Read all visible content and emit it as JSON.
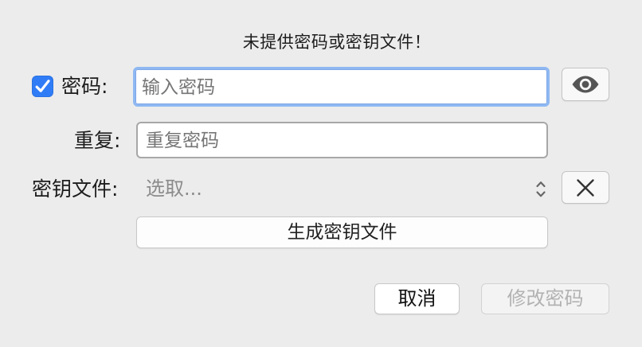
{
  "dialog": {
    "message": "未提供密码或密钥文件！"
  },
  "password": {
    "checkbox_checked": true,
    "label": "密码:",
    "placeholder": "输入密码",
    "value": ""
  },
  "repeat": {
    "label": "重复:",
    "placeholder": "重复密码",
    "value": ""
  },
  "key_file": {
    "label": "密钥文件:",
    "selected": "选取..."
  },
  "buttons": {
    "generate_key_file": "生成密钥文件",
    "cancel": "取消",
    "change_password": "修改密码",
    "change_password_enabled": false
  },
  "icons": {
    "password_visibility": "eye-icon",
    "clear_key_file": "close-icon",
    "select_chevrons": "chevron-up-down-icon",
    "checkbox": "checkmark-icon"
  },
  "colors": {
    "accent": "#2f7cf6",
    "focus_ring": "#8fb8f3",
    "background": "#ececec",
    "disabled_text": "#b2b2b2"
  }
}
